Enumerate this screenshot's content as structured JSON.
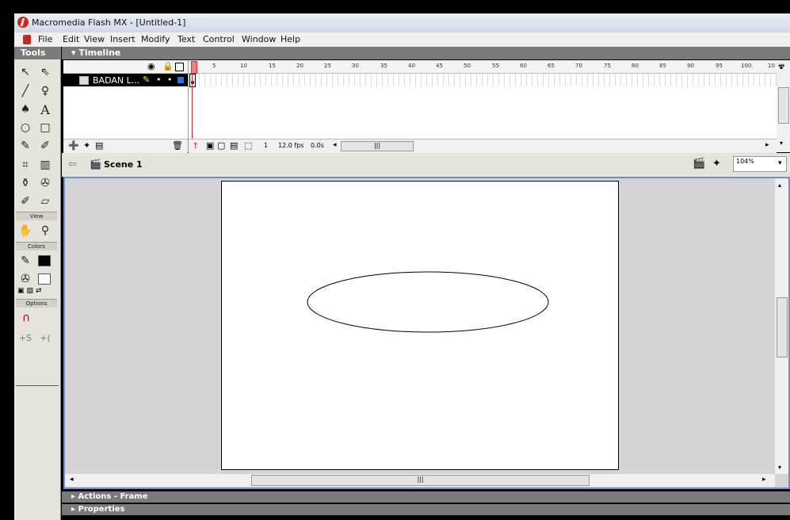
{
  "window": {
    "title": "Macromedia Flash MX - [Untitled-1]"
  },
  "menu": [
    "File",
    "Edit",
    "View",
    "Insert",
    "Modify",
    "Text",
    "Control",
    "Window",
    "Help"
  ],
  "tools": {
    "title": "Tools",
    "sections": {
      "view": "View",
      "colors": "Colors",
      "options": "Options"
    }
  },
  "timeline": {
    "title": "Timeline",
    "layer_name": "BADAN L...",
    "ruler": [
      "5",
      "10",
      "15",
      "20",
      "25",
      "30",
      "35",
      "40",
      "45",
      "50",
      "55",
      "60",
      "65",
      "70",
      "75",
      "80",
      "85",
      "90",
      "95",
      "100",
      "10"
    ],
    "current_frame": "1",
    "frame_rate": "12.0 fps",
    "elapsed": "0.0s"
  },
  "editbar": {
    "scene": "Scene 1",
    "zoom": "104%"
  },
  "panels": {
    "actions": "Actions - Frame",
    "properties": "Properties"
  }
}
